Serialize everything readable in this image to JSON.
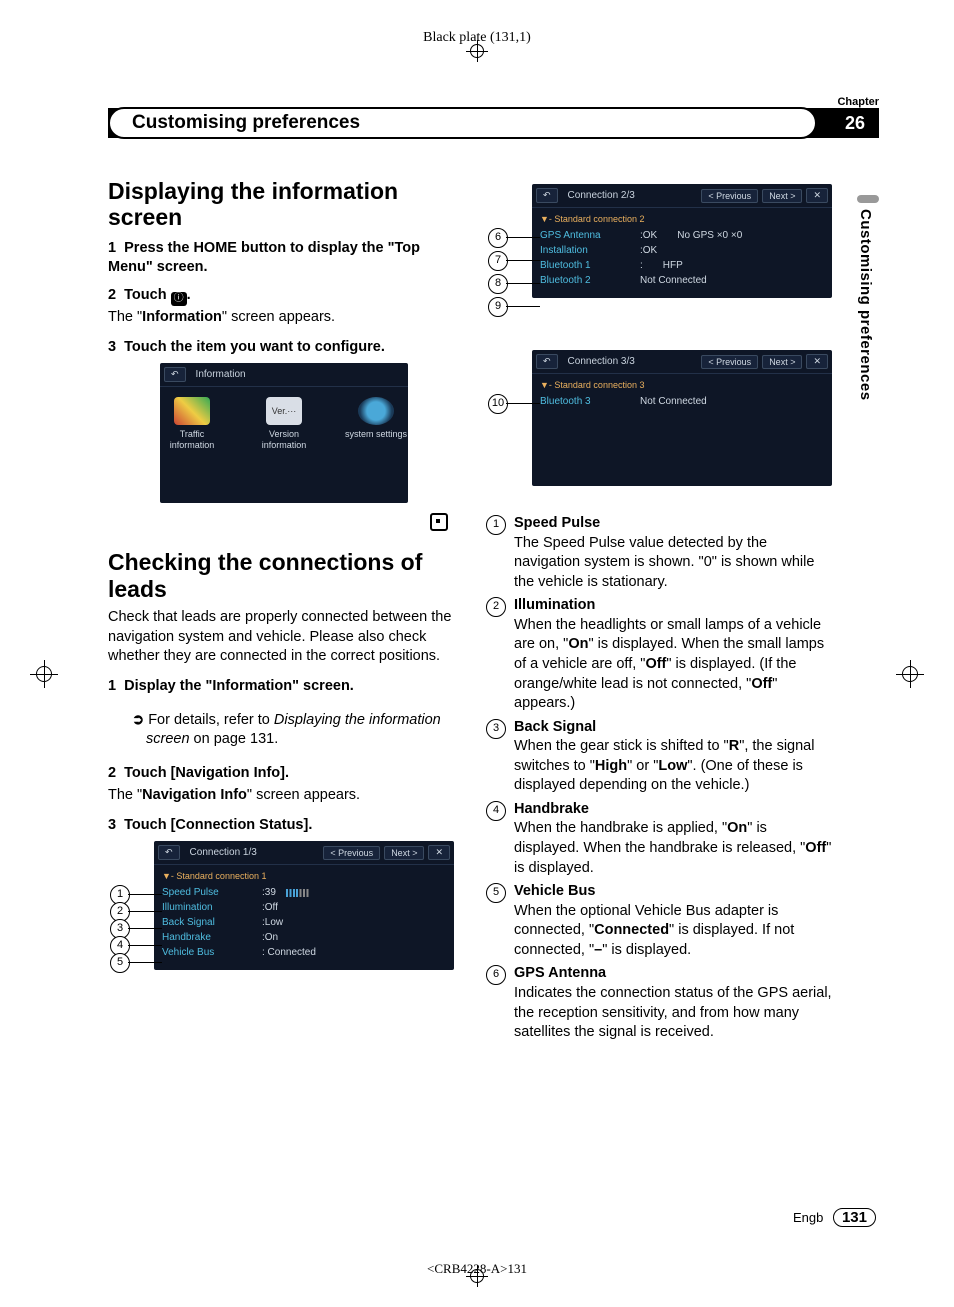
{
  "plate_label": "Black plate (131,1)",
  "chapter_label": "Chapter",
  "chapter_number": "26",
  "chapter_title": "Customising preferences",
  "side_tab": "Customising preferences",
  "left": {
    "section1_title": "Displaying the information screen",
    "step1_num": "1",
    "step1": "Press the HOME button to display the \"Top Menu\" screen.",
    "step2_num": "2",
    "step2_prefix": "Touch ",
    "step2_suffix": ".",
    "step2_result_a": "The \"",
    "step2_result_bold": "Information",
    "step2_result_b": "\" screen appears.",
    "step3_num": "3",
    "step3": "Touch the item you want to configure.",
    "info_ui": {
      "back": "↶",
      "title": "Information",
      "items": [
        {
          "label": "Traffic information"
        },
        {
          "label": "Version information",
          "glyph": "Ver.···"
        },
        {
          "label": "system settings"
        }
      ]
    },
    "section2_title": "Checking the connections of leads",
    "section2_body": "Check that leads are properly connected between the navigation system and vehicle. Please also check whether they are connected in the correct positions.",
    "c_step1_num": "1",
    "c_step1": "Display the \"Information\" screen.",
    "c_step1_sub_a": "For details, refer to ",
    "c_step1_sub_i": "Displaying the information screen",
    "c_step1_sub_b": " on page 131.",
    "c_step2_num": "2",
    "c_step2": "Touch [Navigation Info].",
    "c_step2_result_a": "The \"",
    "c_step2_result_bold": "Navigation Info",
    "c_step2_result_b": "\" screen appears.",
    "c_step3_num": "3",
    "c_step3": "Touch [Connection Status].",
    "conn1": {
      "title": "Connection 1/3",
      "prev": "< Previous",
      "next": "Next  >",
      "close": "✕",
      "group": "▼- Standard connection 1",
      "rows": [
        {
          "n": "1",
          "k": "Speed Pulse",
          "v": ":39",
          "bars": true
        },
        {
          "n": "2",
          "k": "Illumination",
          "v": ":Off"
        },
        {
          "n": "3",
          "k": "Back Signal",
          "v": ":Low"
        },
        {
          "n": "4",
          "k": "Handbrake",
          "v": ":On"
        },
        {
          "n": "5",
          "k": "Vehicle Bus",
          "v": ": Connected"
        }
      ]
    }
  },
  "right": {
    "conn2": {
      "title": "Connection 2/3",
      "prev": "< Previous",
      "next": "Next  >",
      "close": "✕",
      "group": "▼- Standard connection 2",
      "rows": [
        {
          "n": "6",
          "k": "GPS Antenna",
          "v": ":OK",
          "extra": "No GPS  ×0     ×0"
        },
        {
          "n": "7",
          "k": "Installation",
          "v": ":OK"
        },
        {
          "n": "8",
          "k": "Bluetooth 1",
          "v": ":",
          "extra": "HFP"
        },
        {
          "n": "9",
          "k": "Bluetooth 2",
          "v": "Not Connected"
        }
      ]
    },
    "conn3": {
      "title": "Connection 3/3",
      "prev": "< Previous",
      "next": "Next  >",
      "close": "✕",
      "group": "▼- Standard connection 3",
      "rows": [
        {
          "n": "10",
          "k": "Bluetooth 3",
          "v": "Not Connected"
        }
      ]
    },
    "defs": [
      {
        "n": "1",
        "t": "Speed Pulse",
        "d_parts": [
          {
            "txt": "The Speed Pulse value detected by the navigation system is shown. \"0\" is shown while the vehicle is stationary."
          }
        ]
      },
      {
        "n": "2",
        "t": "Illumination",
        "d_parts": [
          {
            "txt": "When the headlights or small lamps of a vehicle are on, \""
          },
          {
            "b": "On"
          },
          {
            "txt": "\" is displayed. When the small lamps of a vehicle are off, \""
          },
          {
            "b": "Off"
          },
          {
            "txt": "\" is displayed. (If the orange/white lead is not connected, \""
          },
          {
            "b": "Off"
          },
          {
            "txt": "\" appears.)"
          }
        ]
      },
      {
        "n": "3",
        "t": "Back Signal",
        "d_parts": [
          {
            "txt": "When the gear stick is shifted to \""
          },
          {
            "b": "R"
          },
          {
            "txt": "\", the signal switches to \""
          },
          {
            "b": "High"
          },
          {
            "txt": "\" or \""
          },
          {
            "b": "Low"
          },
          {
            "txt": "\". (One of these is displayed depending on the vehicle.)"
          }
        ]
      },
      {
        "n": "4",
        "t": "Handbrake",
        "d_parts": [
          {
            "txt": "When the handbrake is applied, \""
          },
          {
            "b": "On"
          },
          {
            "txt": "\" is displayed. When the handbrake is released, \""
          },
          {
            "b": "Off"
          },
          {
            "txt": "\" is displayed."
          }
        ]
      },
      {
        "n": "5",
        "t": "Vehicle Bus",
        "d_parts": [
          {
            "txt": "When the optional Vehicle Bus adapter is connected, \""
          },
          {
            "b": "Connected"
          },
          {
            "txt": "\" is displayed. If not connected, \""
          },
          {
            "b": "–"
          },
          {
            "txt": "\" is displayed."
          }
        ]
      },
      {
        "n": "6",
        "t": "GPS Antenna",
        "d_parts": [
          {
            "txt": "Indicates the connection status of the GPS aerial, the reception sensitivity, and from how many satellites the signal is received."
          }
        ]
      }
    ]
  },
  "footer_lang": "Engb",
  "footer_page": "131",
  "footer_code": "<CRB4228-A>131"
}
